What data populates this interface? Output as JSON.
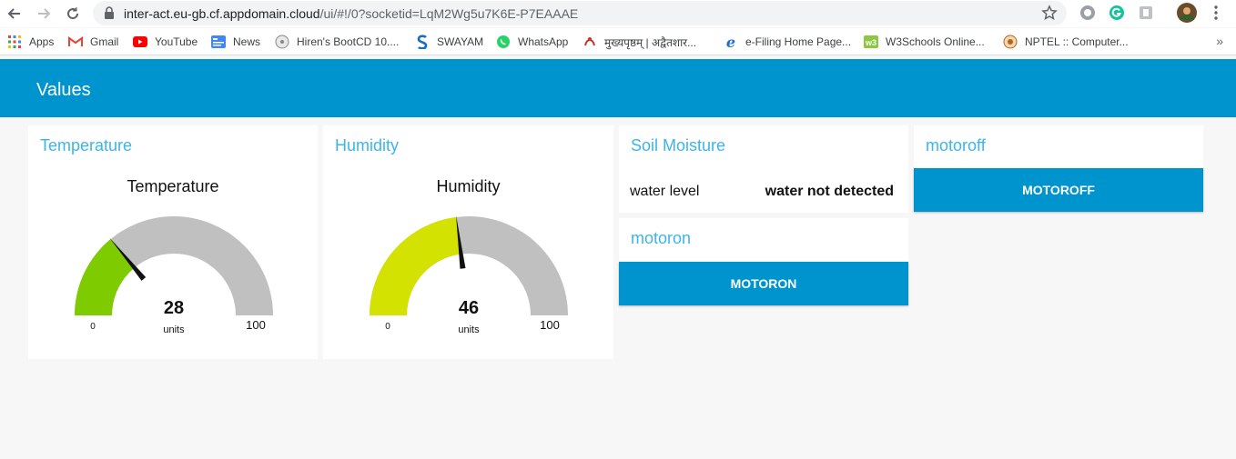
{
  "browser": {
    "url_host": "inter-act.eu-gb.cf.appdomain.cloud",
    "url_path": "/ui/#!/0?socketid=LqM2Wg5u7K6E-P7EAAAE",
    "bookmarks": [
      {
        "label": "Apps",
        "icon": "apps-grid-icon"
      },
      {
        "label": "Gmail",
        "icon": "gmail-icon"
      },
      {
        "label": "YouTube",
        "icon": "youtube-icon"
      },
      {
        "label": "News",
        "icon": "news-icon"
      },
      {
        "label": "Hiren's BootCD 10....",
        "icon": "hirens-icon"
      },
      {
        "label": "SWAYAM",
        "icon": "swayam-icon"
      },
      {
        "label": "WhatsApp",
        "icon": "whatsapp-icon"
      },
      {
        "label": "मुख्यपृष्ठम् | अद्वैतशार...",
        "icon": "advaita-icon"
      },
      {
        "label": "e-Filing Home Page...",
        "icon": "ie-icon"
      },
      {
        "label": "W3Schools Online...",
        "icon": "w3schools-icon"
      },
      {
        "label": "NPTEL :: Computer...",
        "icon": "nptel-icon"
      }
    ],
    "more_label": "»"
  },
  "app": {
    "header_title": "Values"
  },
  "temperature": {
    "card_title": "Temperature",
    "gauge_title": "Temperature",
    "value": 28,
    "value_text": "28",
    "units": "units",
    "min": 0,
    "max": 100,
    "min_text": "0",
    "max_text": "100",
    "color": "#7ecb00"
  },
  "humidity": {
    "card_title": "Humidity",
    "gauge_title": "Humidity",
    "value": 46,
    "value_text": "46",
    "units": "units",
    "min": 0,
    "max": 100,
    "min_text": "0",
    "max_text": "100",
    "color": "#d3e200"
  },
  "soil": {
    "card_title": "Soil Moisture",
    "label": "water level",
    "value": "water not detected"
  },
  "motoron": {
    "card_title": "motoron",
    "button_label": "MOTORON"
  },
  "motoroff": {
    "card_title": "motoroff",
    "button_label": "MOTOROFF"
  },
  "colors": {
    "header": "#0094ce",
    "accent_title": "#3eb5e6",
    "gauge_track": "#c0c0c0"
  }
}
